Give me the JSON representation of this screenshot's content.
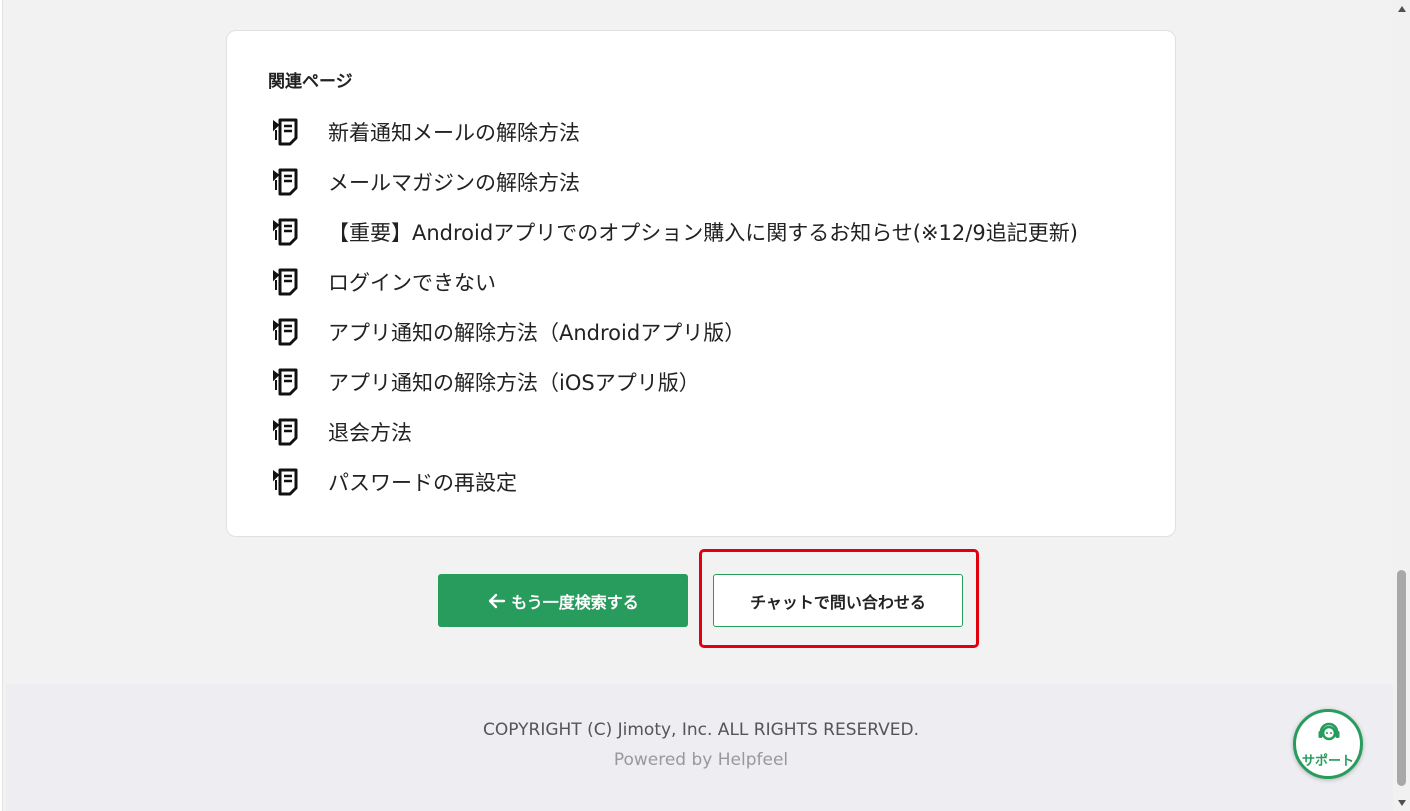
{
  "related": {
    "heading": "関連ページ",
    "items": [
      {
        "label": "新着通知メールの解除方法",
        "icon": "document-icon"
      },
      {
        "label": "メールマガジンの解除方法",
        "icon": "document-icon"
      },
      {
        "label": "【重要】Androidアプリでのオプション購入に関するお知らせ(※12/9追記更新)",
        "icon": "document-icon"
      },
      {
        "label": "ログインできない",
        "icon": "document-icon"
      },
      {
        "label": "アプリ通知の解除方法（Androidアプリ版）",
        "icon": "document-icon"
      },
      {
        "label": "アプリ通知の解除方法（iOSアプリ版）",
        "icon": "document-icon"
      },
      {
        "label": "退会方法",
        "icon": "document-icon"
      },
      {
        "label": "パスワードの再設定",
        "icon": "document-icon"
      }
    ]
  },
  "actions": {
    "back_label": "もう一度検索する",
    "back_icon": "arrow-left-icon",
    "chat_label": "チャットで問い合わせる"
  },
  "footer": {
    "copyright": "COPYRIGHT (C) Jimoty, Inc. ALL RIGHTS RESERVED.",
    "powered": "Powered by Helpfeel"
  },
  "support": {
    "label": "サポート",
    "icon": "headset-person-icon"
  },
  "colors": {
    "accent": "#279c5c",
    "highlight": "#e0000f",
    "background": "#f2f2f2",
    "footer_bg": "#ededf2"
  }
}
